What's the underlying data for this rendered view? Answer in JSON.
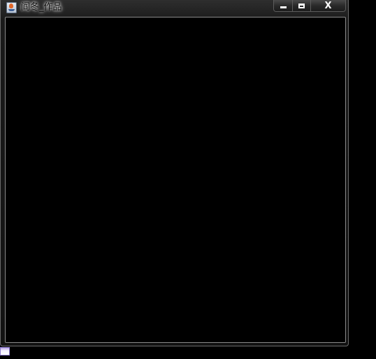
{
  "window": {
    "title": "阎冬_作品",
    "icon": "java-app-icon",
    "buttons": {
      "minimize": "minimize-icon",
      "maximize": "maximize-icon",
      "close": "close-icon"
    },
    "close_glyph": "X"
  },
  "client_area": {
    "background": "#000000"
  }
}
